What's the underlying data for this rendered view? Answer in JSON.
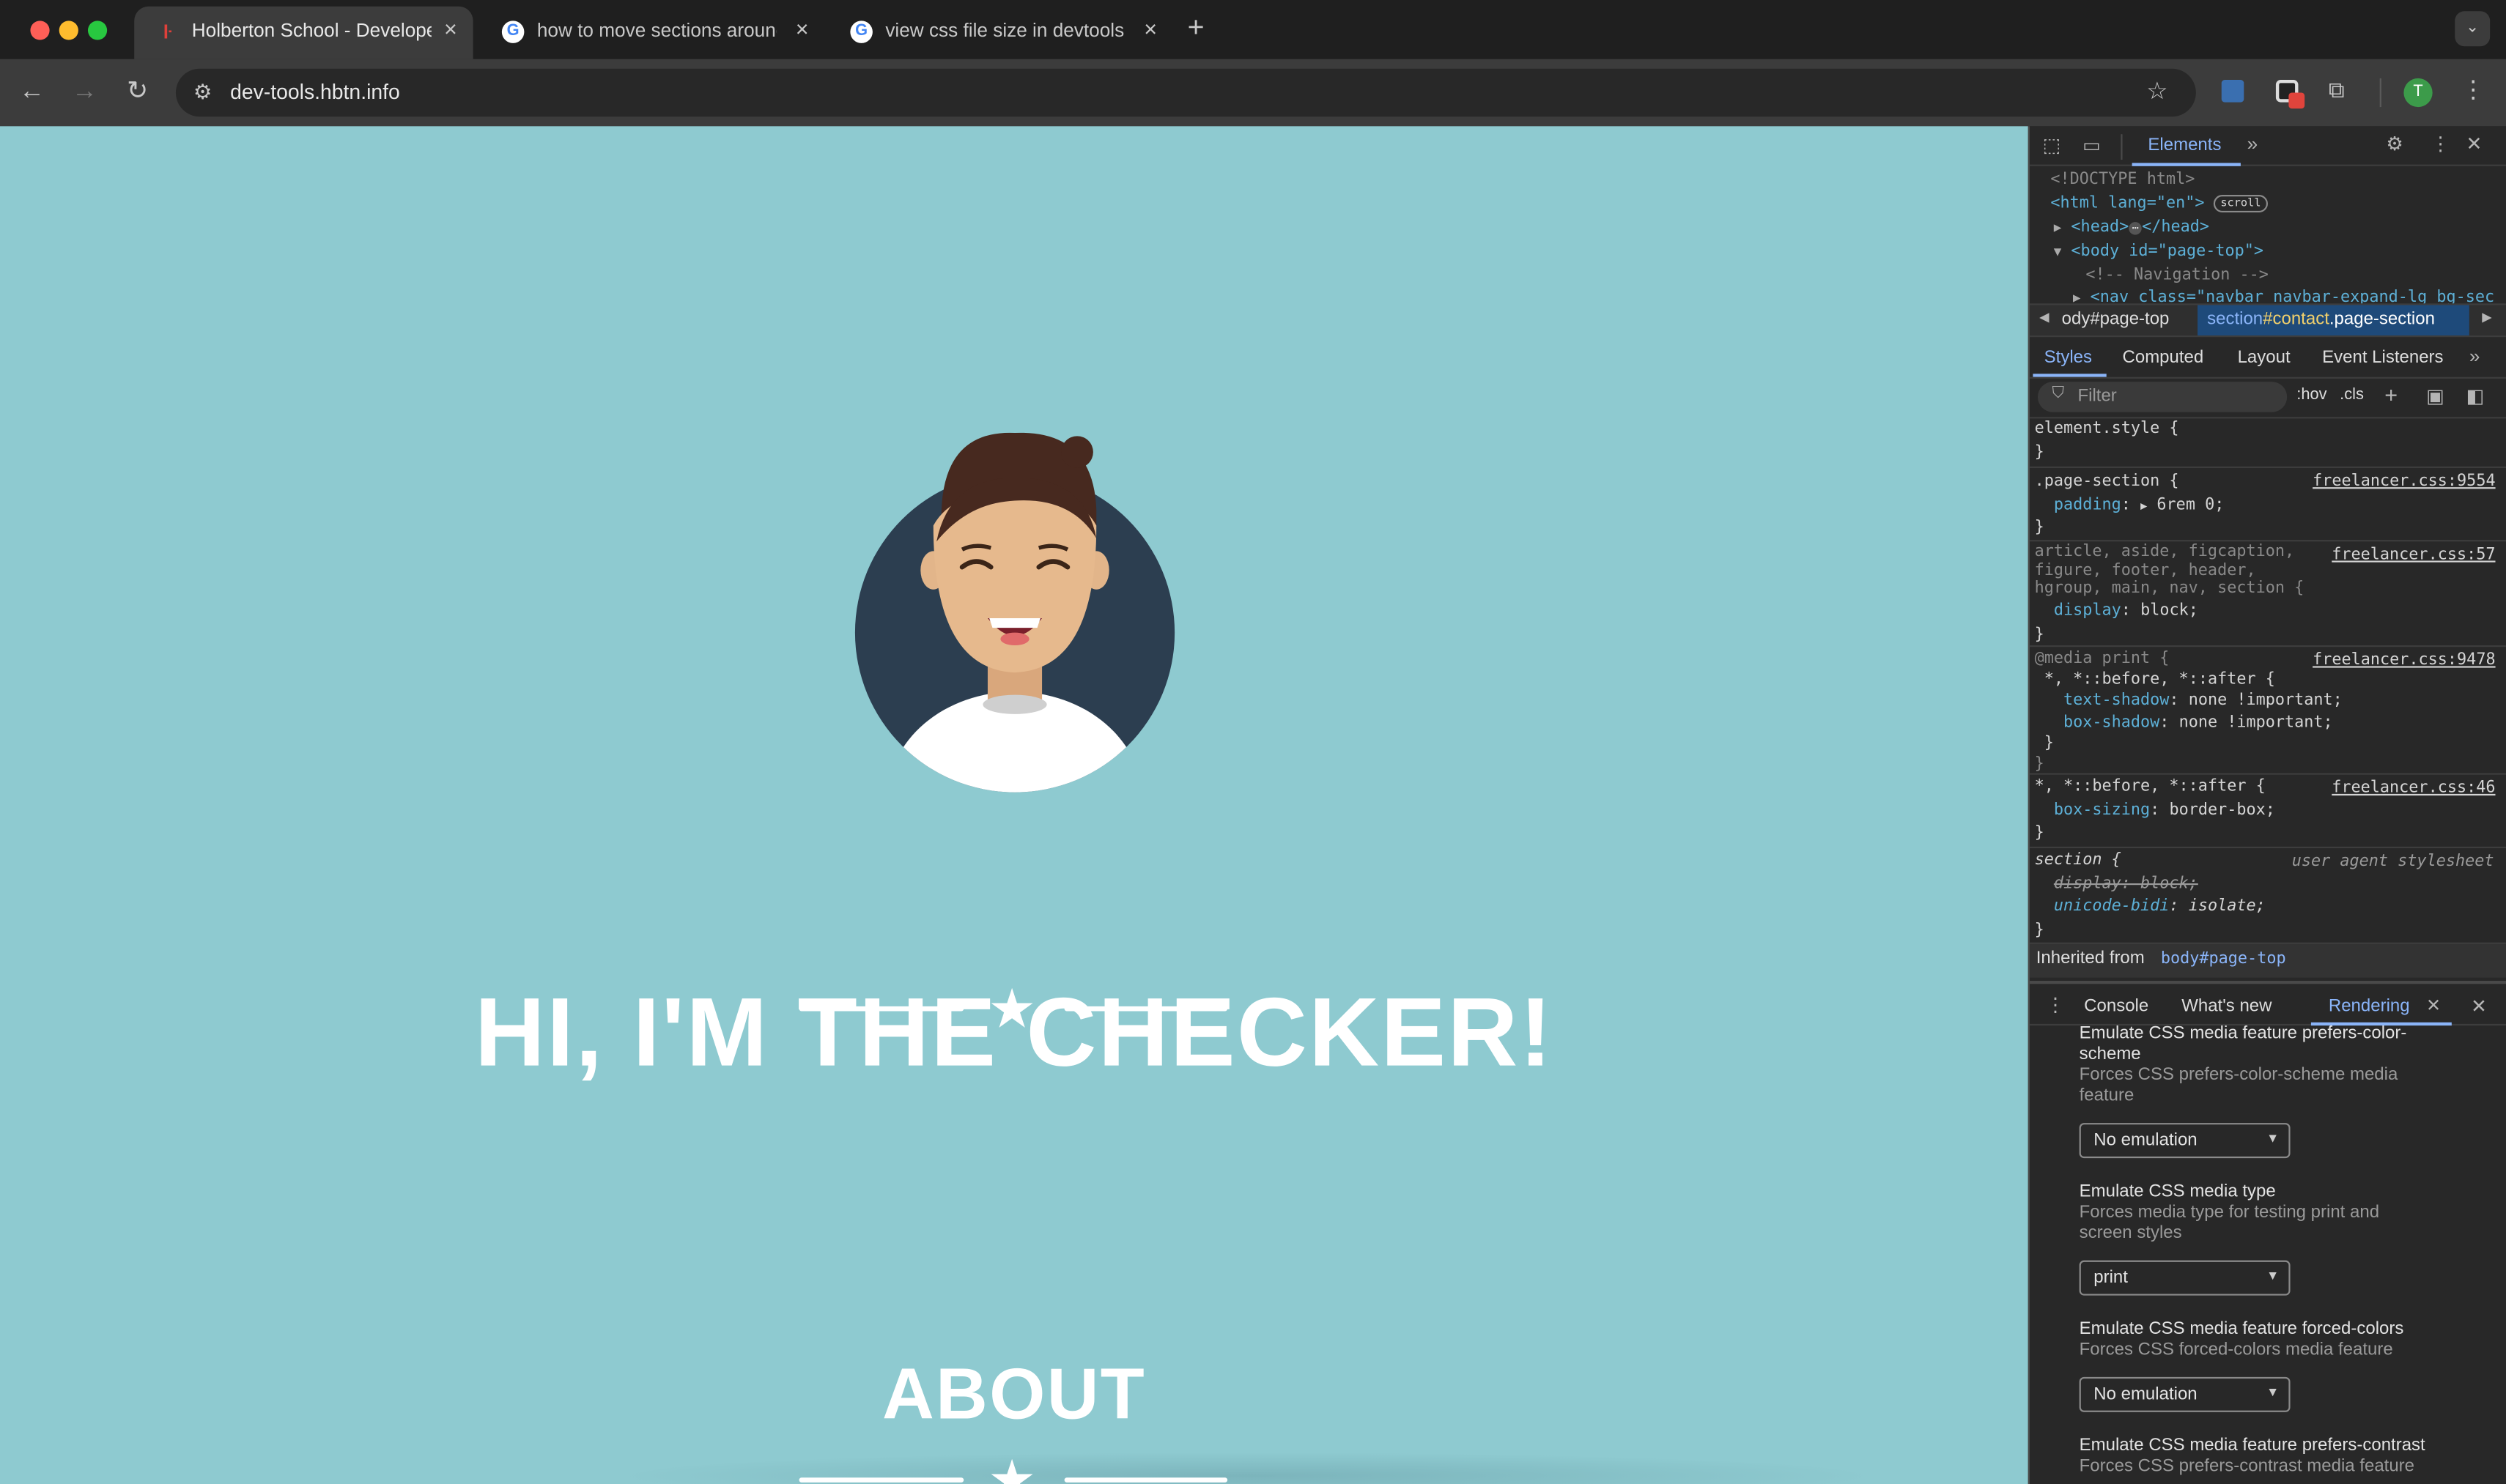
{
  "browser": {
    "tabs": [
      {
        "title": "Holberton School - Developer",
        "close": "×"
      },
      {
        "title": "how to move sections around",
        "close": "×"
      },
      {
        "title": "view css file size in devtools",
        "close": "×"
      }
    ],
    "new_tab": "+",
    "url": "dev-tools.hbtn.info",
    "profile_initial": "T"
  },
  "page": {
    "heading": "HI, I'M THE CHECKER!",
    "about": "ABOUT",
    "colors": {
      "background": "#8ecad0",
      "text": "#ffffff",
      "avatar_bg": "#2c3e50"
    }
  },
  "devtools": {
    "top_tab": "Elements",
    "dom": {
      "doctype": "<!DOCTYPE html>",
      "html_tag": "<html lang=\"en\">",
      "scroll_badge": "scroll",
      "head": "<head>",
      "head_close": "</head>",
      "body": "<body id=\"page-top\">",
      "comment": "<!-- Navigation -->",
      "nav": "<nav class=\"navbar navbar-expand-lg bg-sec"
    },
    "breadcrumb": {
      "item1": "ody#page-top",
      "item2_sel": "section",
      "item2_id": "#contact",
      "item2_class": ".page-section"
    },
    "subtabs": [
      "Styles",
      "Computed",
      "Layout",
      "Event Listeners"
    ],
    "filter_placeholder": "Filter",
    "hov": ":hov",
    "cls": ".cls",
    "rules": {
      "r1_sel": "element.style {",
      "r2_sel": ".page-section {",
      "r2_src": "freelancer.css:9554",
      "r2_prop": "padding",
      "r2_val": "6rem 0;",
      "r3_sel_a": "article, aside, figcaption,",
      "r3_sel_b": "figure, footer, header,",
      "r3_sel_c": "hgroup, main, nav, section {",
      "r3_src": "freelancer.css:57",
      "r3_prop": "display",
      "r3_val": "block;",
      "r4_media": "@media print {",
      "r4_src": "freelancer.css:9478",
      "r4_sel": "*, *::before, *::after {",
      "r4_p1": "text-shadow",
      "r4_v1": "none !important;",
      "r4_p2": "box-shadow",
      "r4_v2": "none !important;",
      "r5_sel": "*, *::before, *::after {",
      "r5_src": "freelancer.css:46",
      "r5_prop": "box-sizing",
      "r5_val": "border-box;",
      "r6_sel": "section {",
      "r6_src": "user agent stylesheet",
      "r6_p1": "display: block;",
      "r6_p2": "unicode-bidi",
      "r6_v2": "isolate;",
      "close": "}"
    },
    "inherited_label": "Inherited from",
    "inherited_from": "body#page-top",
    "drawer_tabs": [
      "Console",
      "What's new",
      "Rendering"
    ],
    "rendering": [
      {
        "title": "Emulate CSS media feature prefers-color-scheme",
        "desc": "Forces CSS prefers-color-scheme media feature",
        "value": "No emulation"
      },
      {
        "title": "Emulate CSS media type",
        "desc": "Forces media type for testing print and screen styles",
        "value": "print"
      },
      {
        "title": "Emulate CSS media feature forced-colors",
        "desc": "Forces CSS forced-colors media feature",
        "value": "No emulation"
      },
      {
        "title": "Emulate CSS media feature prefers-contrast",
        "desc": "Forces CSS prefers-contrast media feature",
        "value": ""
      }
    ]
  }
}
